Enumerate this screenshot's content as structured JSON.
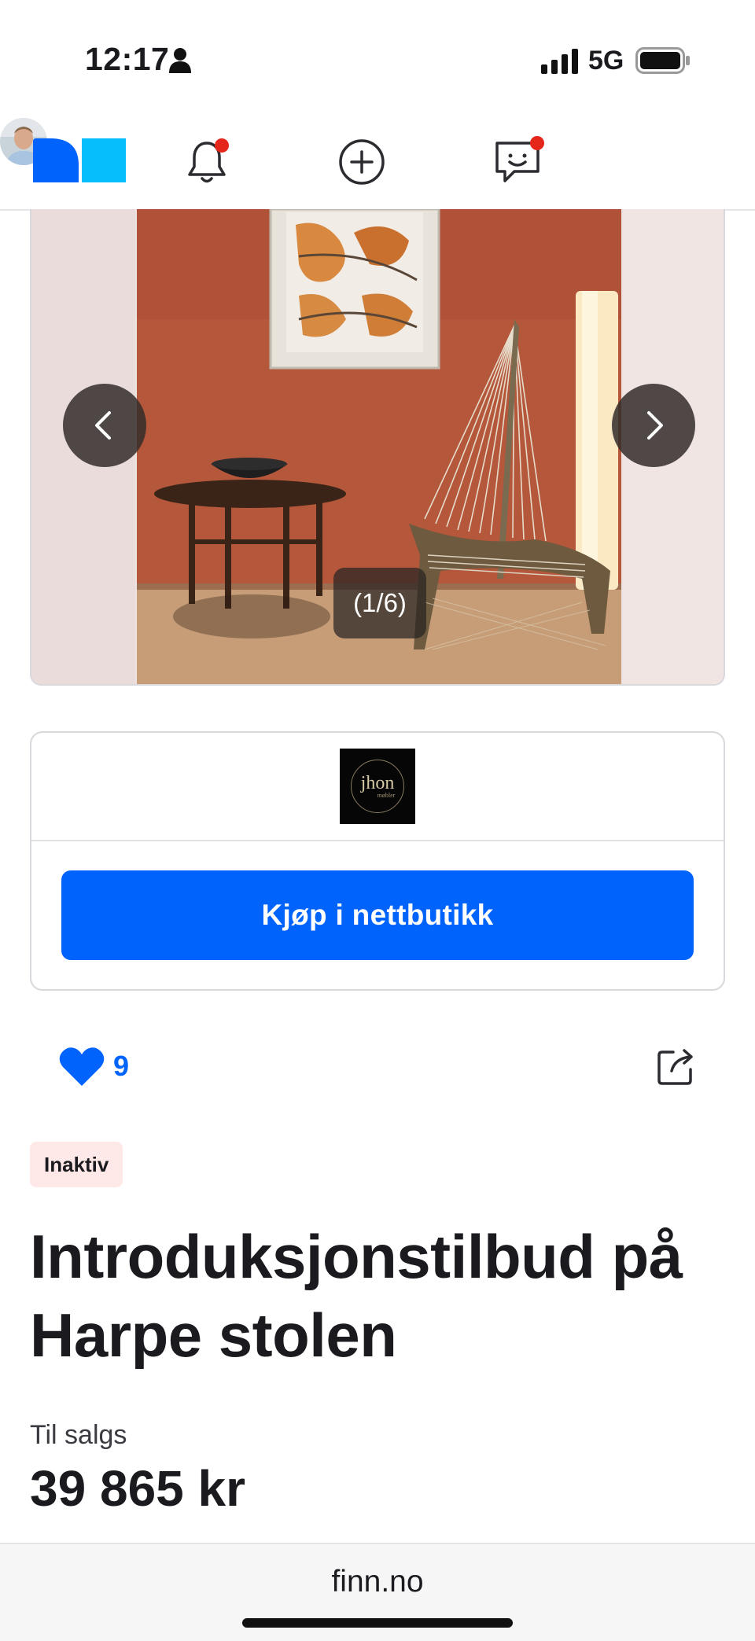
{
  "status_bar": {
    "time": "12:17",
    "network": "5G",
    "icons": [
      "person-icon",
      "signal-icon",
      "battery-icon"
    ]
  },
  "nav": {
    "logo": "finn-logo",
    "items": [
      "bell-icon",
      "add-icon",
      "messages-icon",
      "avatar"
    ],
    "notification_dot_color": "#e5261b",
    "brand_colors": [
      "#0063fb",
      "#06befb"
    ]
  },
  "carousel": {
    "counter": "(1/6)",
    "prev_icon": "chevron-left-icon",
    "next_icon": "chevron-right-icon"
  },
  "store": {
    "logo_name": "jhon",
    "logo_sub": "møbler",
    "buy_label": "Kjøp i nettbutikk",
    "button_color": "#0063fb"
  },
  "favorites": {
    "count": "9",
    "icon": "heart-icon",
    "share_icon": "share-icon"
  },
  "listing": {
    "status": "Inaktiv",
    "title": "Introduksjonstilbud på Harpe stolen",
    "price_label": "Til salgs",
    "price": "39 865 kr"
  },
  "browser": {
    "url": "finn.no"
  }
}
